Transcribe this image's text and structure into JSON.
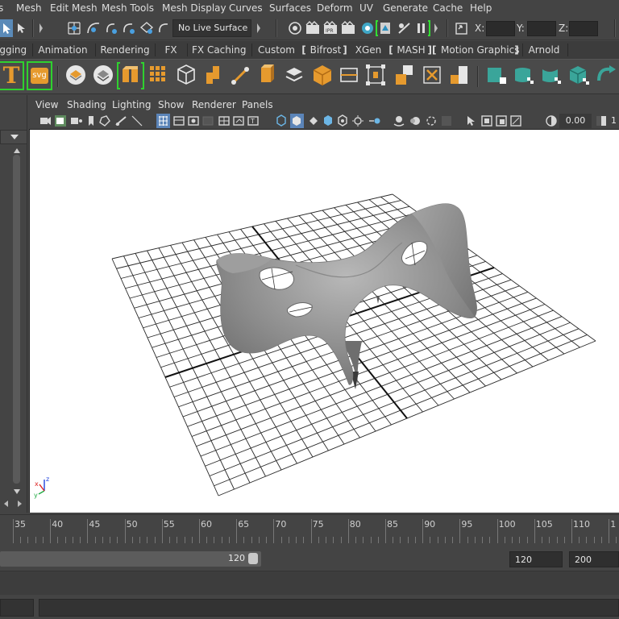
{
  "menubar": {
    "items": [
      "s",
      "Mesh",
      "Edit Mesh",
      "Mesh Tools",
      "Mesh Display",
      "Curves",
      "Surfaces",
      "Deform",
      "UV",
      "Generate",
      "Cache",
      "Help"
    ]
  },
  "status_line": {
    "live_surface": "No Live Surface",
    "x_label": "X:",
    "y_label": "Y:",
    "z_label": "Z:"
  },
  "shelf_tabs": [
    "igging",
    "Animation",
    "Rendering",
    "FX",
    "FX Caching",
    "Custom",
    "Bifrost",
    "XGen",
    "MASH",
    "Motion Graphics",
    "Arnold"
  ],
  "shelf": {
    "text_tool_label": "T",
    "svg_tool_label": "svg"
  },
  "viewport": {
    "menu": [
      "View",
      "Shading",
      "Lighting",
      "Show",
      "Renderer",
      "Panels"
    ],
    "exposure_value": "0.00",
    "partial_value": "1"
  },
  "timeline": {
    "ticks": [
      "35",
      "40",
      "45",
      "50",
      "55",
      "60",
      "65",
      "70",
      "75",
      "80",
      "85",
      "90",
      "95",
      "100",
      "105",
      "110",
      "1"
    ]
  },
  "range": {
    "playback_end": "120",
    "animation_end": "120",
    "max": "200"
  },
  "colors": {
    "ui_background": "#444444",
    "viewport_background": "#ffffff",
    "bracket_green": "#33dd33",
    "shelf_orange": "#e69a2e",
    "shelf_teal": "#3aa59a"
  }
}
